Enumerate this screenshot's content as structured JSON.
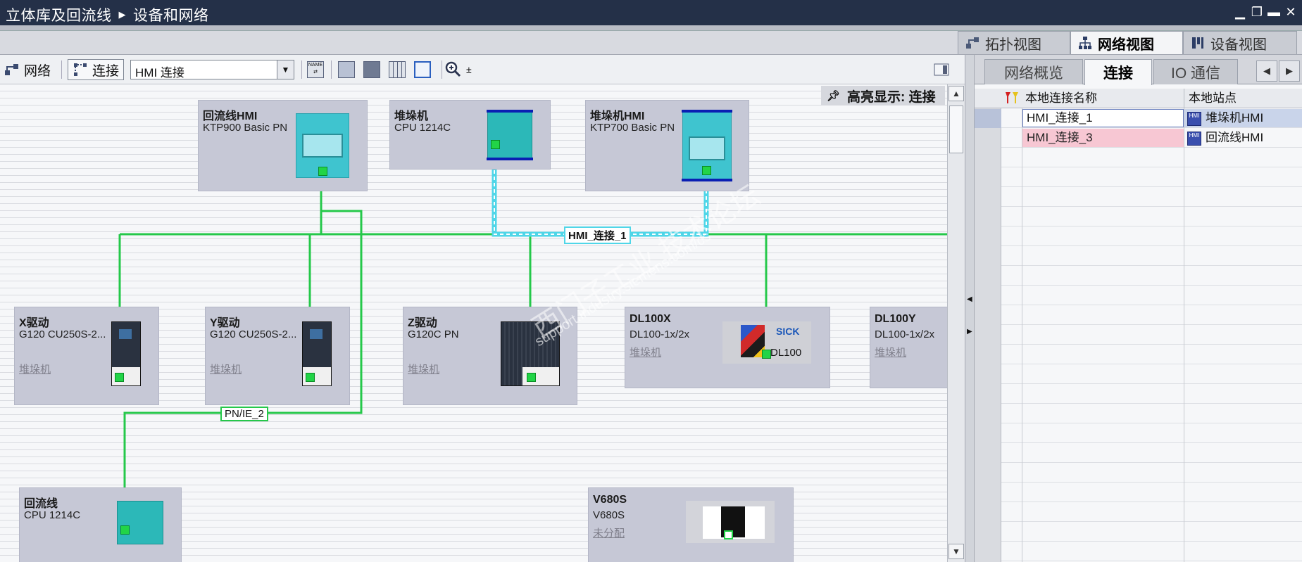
{
  "window": {
    "breadcrumb_project": "立体库及回流线",
    "breadcrumb_page": "设备和网络"
  },
  "view_tabs": {
    "topology": "拓扑视图",
    "network": "网络视图",
    "device": "设备视图"
  },
  "toolbar": {
    "network_label": "网络",
    "connect_label": "连接",
    "connection_type": "HMI 连接"
  },
  "canvas": {
    "highlight_label": "高亮显示: 连接",
    "devices": [
      {
        "name": "回流线HMI",
        "type": "KTP900 Basic PN",
        "link": ""
      },
      {
        "name": "堆垛机",
        "type": "CPU 1214C",
        "link": ""
      },
      {
        "name": "堆垛机HMI",
        "type": "KTP700 Basic PN",
        "link": ""
      },
      {
        "name": "X驱动",
        "type": "G120  CU250S-2...",
        "link": "堆垛机"
      },
      {
        "name": "Y驱动",
        "type": "G120  CU250S-2...",
        "link": "堆垛机"
      },
      {
        "name": "Z驱动",
        "type": "G120C PN",
        "link": "堆垛机"
      },
      {
        "name": "DL100X",
        "type": "DL100-1x/2x",
        "link": "堆垛机"
      },
      {
        "name": "DL100Y",
        "type": "DL100-1x/2x",
        "link": "堆垛机"
      },
      {
        "name": "回流线",
        "type": "CPU 1214C",
        "link": ""
      },
      {
        "name": "V680S",
        "type": "V680S",
        "link": "未分配"
      }
    ],
    "sick_brand": "SICK",
    "sick_model": "DL100",
    "net_label_hmi": "HMI_连接_1",
    "net_label_pnie": "PN/IE_2",
    "watermark_cn": "西门子工业  技术论坛",
    "watermark_url": "support.industry.siemens.com/cs"
  },
  "right_panel": {
    "tabs": [
      "网络概览",
      "连接",
      "IO 通信"
    ],
    "columns": [
      "本地连接名称",
      "本地站点"
    ],
    "rows": [
      {
        "name": "HMI_连接_1",
        "station": "堆垛机HMI"
      },
      {
        "name": "HMI_连接_3",
        "station": "回流线HMI"
      }
    ],
    "hmi_icon_text": "HMI"
  },
  "colors": {
    "titlebar": "#243048",
    "network_line": "#25c84a",
    "hmi_connection": "#4fd6e8",
    "device_box": "#c6c8d6",
    "row_selected": "#c9d4ea",
    "row_highlight": "#f7c7d3"
  }
}
